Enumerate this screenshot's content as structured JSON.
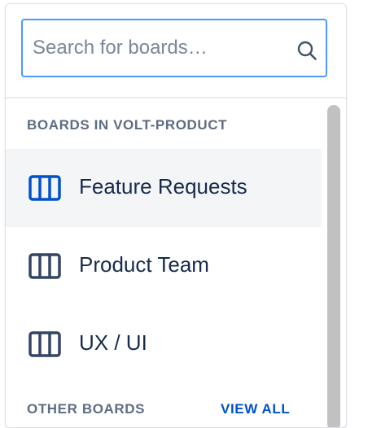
{
  "search": {
    "placeholder": "Search for boards…",
    "value": "",
    "icon": "search-icon"
  },
  "boards_section": {
    "header": "BOARDS IN VOLT-PRODUCT",
    "items": [
      {
        "label": "Feature Requests",
        "icon": "board-columns-icon",
        "selected": true
      },
      {
        "label": "Product Team",
        "icon": "board-columns-icon",
        "selected": false
      },
      {
        "label": "UX / UI",
        "icon": "board-columns-icon",
        "selected": false
      }
    ]
  },
  "other_section": {
    "header": "OTHER BOARDS",
    "view_all_label": "VIEW ALL"
  },
  "colors": {
    "selected_icon": "#0052cc",
    "default_icon": "#344563",
    "focus_border": "#4c9aff",
    "selected_row_bg": "#f4f5f7"
  }
}
